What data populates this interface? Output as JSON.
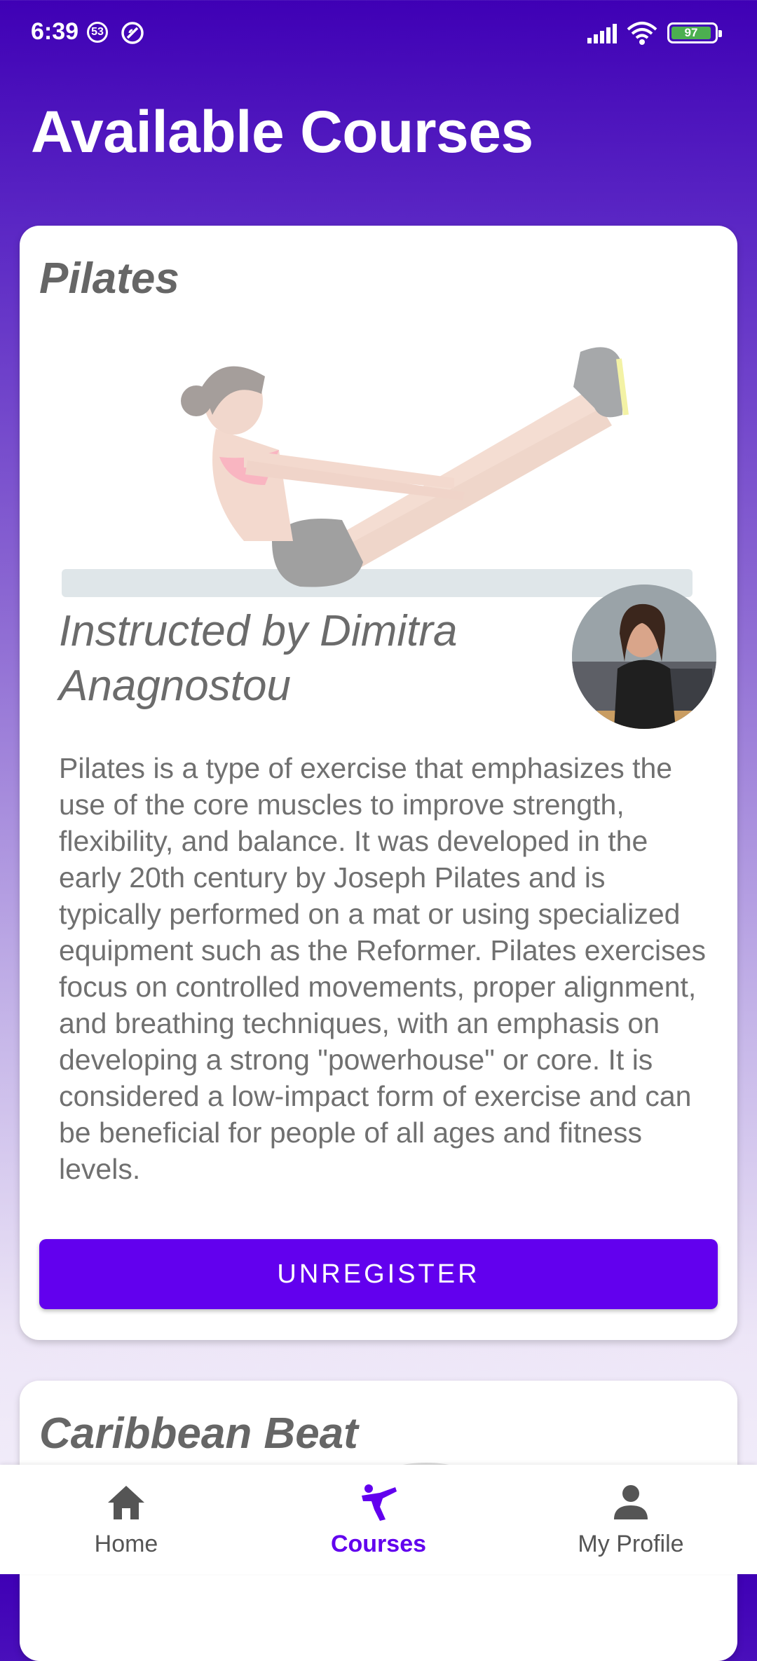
{
  "status_bar": {
    "time": "6:39",
    "notification_count": "53",
    "battery": "97"
  },
  "header": {
    "title": "Available Courses"
  },
  "courses": [
    {
      "title": "Pilates",
      "instructor": "Instructed by Dimitra Anagnostou",
      "description": "Pilates is a type of exercise that emphasizes the use of the core muscles to improve strength, flexibility, and balance. It was developed in the early 20th century by Joseph Pilates and is typically performed on a mat or using specialized equipment such as the Reformer. Pilates exercises focus on controlled movements, proper alignment, and breathing techniques, with an emphasis on developing a strong \"powerhouse\" or core. It is considered a low-impact form of exercise and can be beneficial for people of all ages and fitness levels.",
      "action_label": "UNREGISTER"
    },
    {
      "title": "Caribbean Beat"
    }
  ],
  "bottom_nav": [
    {
      "label": "Home",
      "icon": "home-icon"
    },
    {
      "label": "Courses",
      "icon": "martial-arts-icon",
      "active": true
    },
    {
      "label": "My Profile",
      "icon": "person-icon"
    }
  ],
  "colors": {
    "accent": "#6200ee",
    "header_gradient_top": "#3f00b5"
  }
}
